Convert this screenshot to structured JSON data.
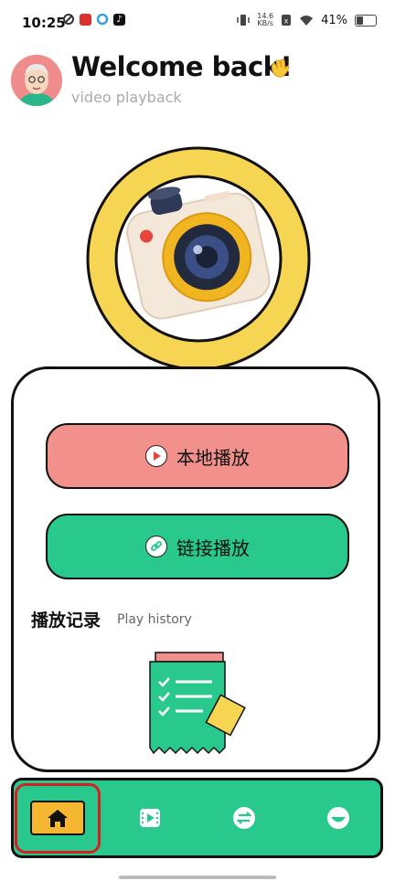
{
  "status_bar": {
    "time": "10:25",
    "net_speed_value": "14.6",
    "net_speed_unit": "KB/s",
    "battery_percent": "41%",
    "battery_level": 0.41
  },
  "header": {
    "title": "Welcome back!",
    "wave_emoji": "👋",
    "subtitle": "video playback"
  },
  "actions": {
    "local_play_label": "本地播放",
    "link_play_label": "链接播放"
  },
  "history": {
    "title": "播放记录",
    "subtitle": "Play history"
  },
  "bottom_nav": {
    "items": [
      {
        "icon": "home-icon",
        "active": true
      },
      {
        "icon": "video-icon",
        "active": false
      },
      {
        "icon": "swap-icon",
        "active": false
      },
      {
        "icon": "face-icon",
        "active": false
      }
    ]
  },
  "colors": {
    "accent_green": "#29c98d",
    "accent_pink": "#f2908c",
    "accent_yellow": "#f5b731",
    "ring_yellow": "#f6d552",
    "highlight_red": "#d62020"
  }
}
